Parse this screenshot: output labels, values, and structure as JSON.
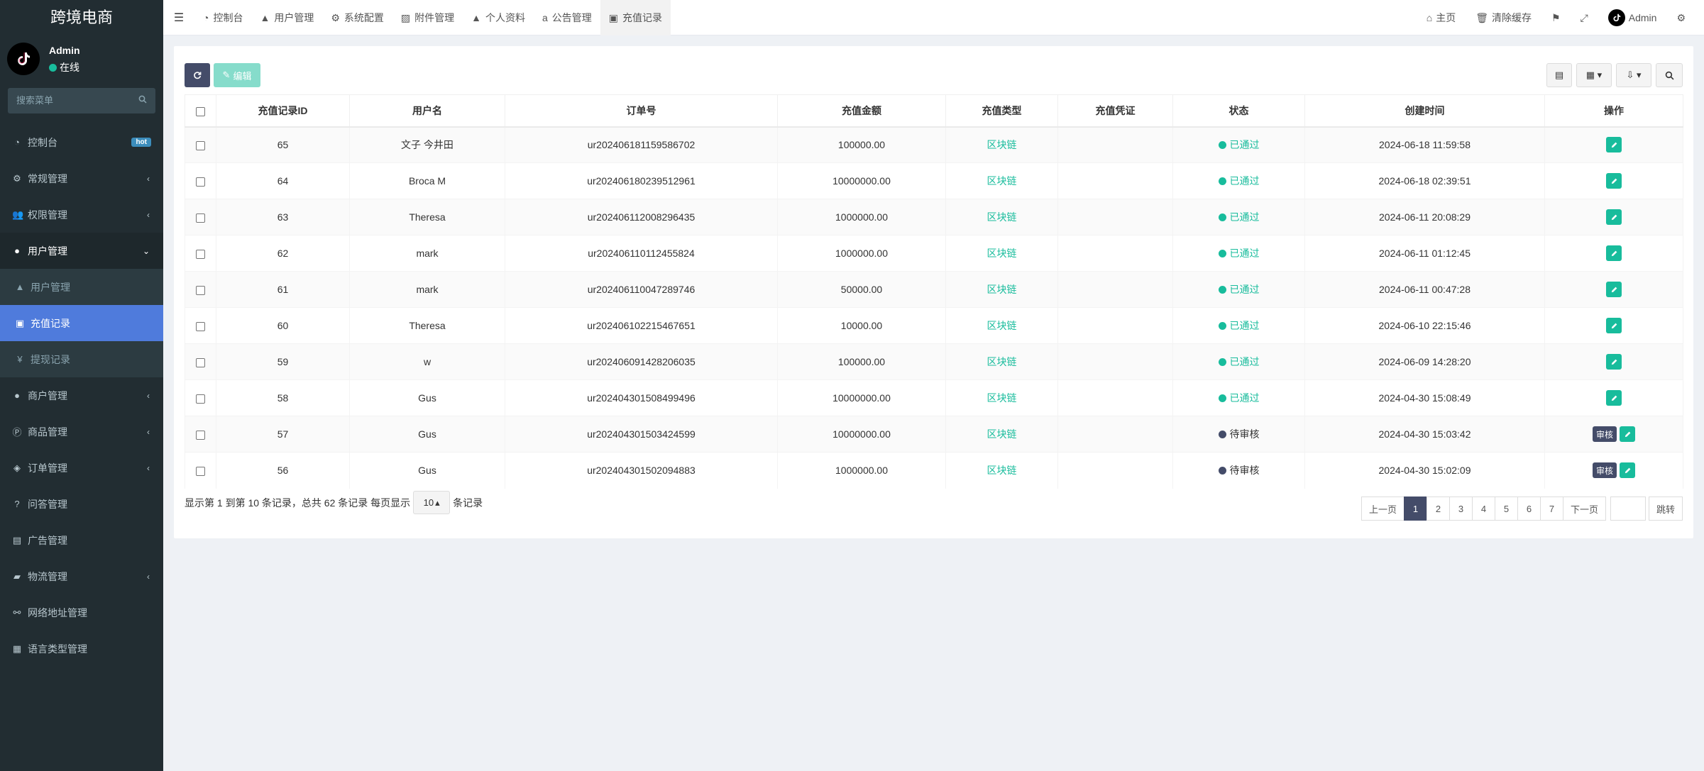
{
  "app": {
    "brand": "跨境电商"
  },
  "user": {
    "name": "Admin",
    "status": "在线"
  },
  "search": {
    "placeholder": "搜索菜单"
  },
  "menu": [
    {
      "label": "控制台",
      "icon": "dashboard-icon",
      "badge": "hot"
    },
    {
      "label": "常规管理",
      "icon": "cogs-icon"
    },
    {
      "label": "权限管理",
      "icon": "group-icon"
    },
    {
      "label": "用户管理",
      "icon": "user-circle-icon"
    },
    {
      "label": "用户管理",
      "icon": "user-icon"
    },
    {
      "label": "充值记录",
      "icon": "money-icon"
    },
    {
      "label": "提现记录",
      "icon": "yen-icon"
    },
    {
      "label": "商户管理",
      "icon": "apple-icon"
    },
    {
      "label": "商品管理",
      "icon": "product-icon"
    },
    {
      "label": "订单管理",
      "icon": "cube-icon"
    },
    {
      "label": "问答管理",
      "icon": "question-icon"
    },
    {
      "label": "广告管理",
      "icon": "ad-icon"
    },
    {
      "label": "物流管理",
      "icon": "truck-icon"
    },
    {
      "label": "网络地址管理",
      "icon": "link-icon"
    },
    {
      "label": "语言类型管理",
      "icon": "language-icon"
    }
  ],
  "tabs": [
    {
      "label": "控制台",
      "icon": "dashboard-icon"
    },
    {
      "label": "用户管理",
      "icon": "user-icon"
    },
    {
      "label": "系统配置",
      "icon": "cog-icon"
    },
    {
      "label": "附件管理",
      "icon": "image-icon"
    },
    {
      "label": "个人资料",
      "icon": "user-icon"
    },
    {
      "label": "公告管理",
      "icon": "amazon-icon"
    },
    {
      "label": "充值记录",
      "icon": "money-icon"
    }
  ],
  "header_right": {
    "home": "主页",
    "clear_cache": "清除缓存",
    "admin": "Admin"
  },
  "toolbar": {
    "edit_label": "编辑"
  },
  "table": {
    "columns": [
      "充值记录ID",
      "用户名",
      "订单号",
      "充值金额",
      "充值类型",
      "充值凭证",
      "状态",
      "创建时间",
      "操作"
    ],
    "rows": [
      {
        "id": "65",
        "username": "文子 今井田",
        "order": "ur202406181159586702",
        "amount": "100000.00",
        "type": "区块链",
        "voucher": "",
        "status": "已通过",
        "created": "2024-06-18 11:59:58",
        "audit": false
      },
      {
        "id": "64",
        "username": "Broca M",
        "order": "ur202406180239512961",
        "amount": "10000000.00",
        "type": "区块链",
        "voucher": "",
        "status": "已通过",
        "created": "2024-06-18 02:39:51",
        "audit": false
      },
      {
        "id": "63",
        "username": "Theresa",
        "order": "ur202406112008296435",
        "amount": "1000000.00",
        "type": "区块链",
        "voucher": "",
        "status": "已通过",
        "created": "2024-06-11 20:08:29",
        "audit": false
      },
      {
        "id": "62",
        "username": "mark",
        "order": "ur202406110112455824",
        "amount": "1000000.00",
        "type": "区块链",
        "voucher": "",
        "status": "已通过",
        "created": "2024-06-11 01:12:45",
        "audit": false
      },
      {
        "id": "61",
        "username": "mark",
        "order": "ur202406110047289746",
        "amount": "50000.00",
        "type": "区块链",
        "voucher": "",
        "status": "已通过",
        "created": "2024-06-11 00:47:28",
        "audit": false
      },
      {
        "id": "60",
        "username": "Theresa",
        "order": "ur202406102215467651",
        "amount": "10000.00",
        "type": "区块链",
        "voucher": "",
        "status": "已通过",
        "created": "2024-06-10 22:15:46",
        "audit": false
      },
      {
        "id": "59",
        "username": "w",
        "order": "ur202406091428206035",
        "amount": "100000.00",
        "type": "区块链",
        "voucher": "",
        "status": "已通过",
        "created": "2024-06-09 14:28:20",
        "audit": false
      },
      {
        "id": "58",
        "username": "Gus",
        "order": "ur202404301508499496",
        "amount": "10000000.00",
        "type": "区块链",
        "voucher": "",
        "status": "已通过",
        "created": "2024-04-30 15:08:49",
        "audit": false
      },
      {
        "id": "57",
        "username": "Gus",
        "order": "ur202404301503424599",
        "amount": "10000000.00",
        "type": "区块链",
        "voucher": "",
        "status": "待审核",
        "created": "2024-04-30 15:03:42",
        "audit": true
      },
      {
        "id": "56",
        "username": "Gus",
        "order": "ur202404301502094883",
        "amount": "1000000.00",
        "type": "区块链",
        "voucher": "",
        "status": "待审核",
        "created": "2024-04-30 15:02:09",
        "audit": true
      }
    ],
    "audit_label": "审核"
  },
  "footer": {
    "summary": "显示第 1 到第 10 条记录，总共 62 条记录 每页显示",
    "page_size": "10",
    "suffix": "条记录"
  },
  "pager": {
    "prev": "上一页",
    "pages": [
      "1",
      "2",
      "3",
      "4",
      "5",
      "6",
      "7"
    ],
    "next": "下一页",
    "jump": "跳转"
  },
  "colors": {
    "accent": "#18bc9c",
    "dark": "#444c69",
    "sidebar": "#222d32",
    "active_menu": "#4f7bdc"
  }
}
